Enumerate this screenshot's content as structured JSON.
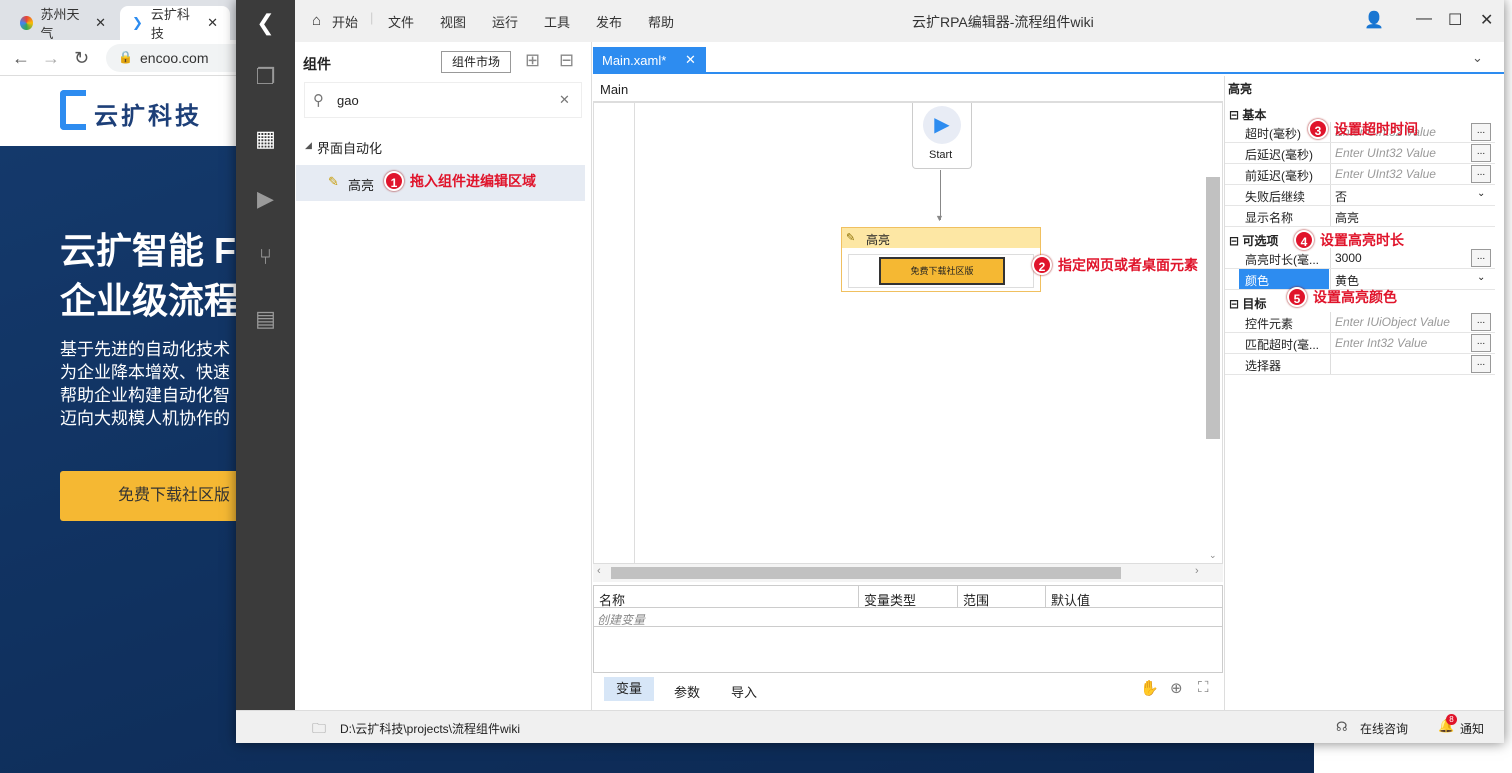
{
  "browser": {
    "tabs": [
      {
        "label": "苏州天气"
      },
      {
        "label": "云扩科技"
      }
    ],
    "url": "encoo.com"
  },
  "site": {
    "logo": "云扩科技",
    "hero_line1": "云扩智能 F",
    "hero_line2": "企业级流程",
    "desc": [
      "基于先进的自动化技术",
      "为企业降本增效、快速",
      "帮助企业构建自动化智",
      "迈向大规模人机协作的"
    ],
    "download_btn": "免费下载社区版"
  },
  "editor": {
    "title": "云扩RPA编辑器-流程组件wiki",
    "menu": [
      "开始",
      "文件",
      "视图",
      "运行",
      "工具",
      "发布",
      "帮助"
    ],
    "components": {
      "heading": "组件",
      "market_btn": "组件市场",
      "search_value": "gao",
      "category": "界面自动化",
      "item": "高亮"
    },
    "doc_tab": "Main.xaml*",
    "breadcrumb": "Main",
    "flow": {
      "start_label": "Start",
      "activity_title": "高亮",
      "target_btn": "免费下载社区版"
    },
    "vars": {
      "headers": [
        "名称",
        "变量类型",
        "范围",
        "默认值"
      ],
      "create": "创建变量",
      "tabs": [
        "变量",
        "参数",
        "导入"
      ]
    },
    "props": {
      "title": "高亮",
      "sections": [
        "基本",
        "可选项",
        "目标"
      ],
      "rows": [
        {
          "label": "超时(毫秒)",
          "value": "Enter UInt32 Value",
          "placeholder": true,
          "dots": true
        },
        {
          "label": "后延迟(毫秒)",
          "value": "Enter UInt32 Value",
          "placeholder": true,
          "dots": true
        },
        {
          "label": "前延迟(毫秒)",
          "value": "Enter UInt32 Value",
          "placeholder": true,
          "dots": true
        },
        {
          "label": "失败后继续",
          "value": "否",
          "placeholder": false,
          "dots": false
        },
        {
          "label": "显示名称",
          "value": "高亮",
          "placeholder": false,
          "dots": false
        },
        {
          "label": "高亮时长(毫...",
          "value": "3000",
          "placeholder": false,
          "dots": true
        },
        {
          "label": "颜色",
          "value": "黄色",
          "placeholder": false,
          "dots": false
        },
        {
          "label": "控件元素",
          "value": "Enter IUiObject Value",
          "placeholder": true,
          "dots": true
        },
        {
          "label": "匹配超时(毫...",
          "value": "Enter Int32 Value",
          "placeholder": true,
          "dots": true
        },
        {
          "label": "选择器",
          "value": "",
          "placeholder": false,
          "dots": true
        }
      ]
    },
    "status": {
      "path": "D:\\云扩科技\\projects\\流程组件wiki",
      "consult": "在线咨询",
      "notify": "通知",
      "notify_count": "8"
    }
  },
  "annotations": [
    {
      "n": "1",
      "text": "拖入组件进编辑区域"
    },
    {
      "n": "2",
      "text": "指定网页或者桌面元素"
    },
    {
      "n": "3",
      "text": "设置超时时间"
    },
    {
      "n": "4",
      "text": "设置高亮时长"
    },
    {
      "n": "5",
      "text": "设置高亮颜色"
    }
  ],
  "colors": {
    "accent": "#2d8cf0",
    "annotation": "#e0142b",
    "highlight": "#f5b833",
    "sidebar": "#3b3b3b"
  }
}
